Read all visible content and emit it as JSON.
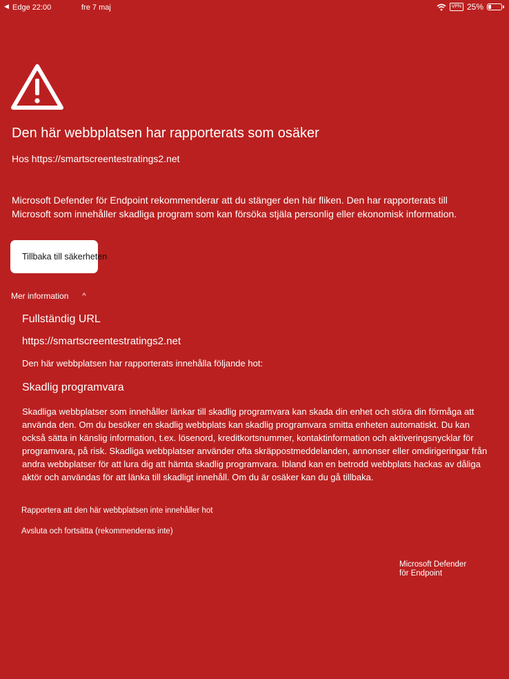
{
  "status_bar": {
    "back_arrow": "◀",
    "app_time": "Edge 22:00",
    "date": "fre 7 maj",
    "vpn": "VPN",
    "battery_percent": "25%",
    "battery_level": 0.25
  },
  "warning": {
    "title": "Den här webbplatsen har rapporterats som osäker",
    "site": "Hos https://smartscreentestratings2.net",
    "message": "Microsoft Defender för Endpoint rekommenderar att du stänger den här fliken. Den har rapporterats till Microsoft som innehåller skadliga program som kan försöka stjäla personlig eller ekonomisk information.",
    "back_button": "Tillbaka till säkerheten"
  },
  "more_info": {
    "toggle_label": "Mer information",
    "chevron": "^",
    "full_url_heading": "Fullständig URL",
    "full_url": "https://smartscreentestratings2.net",
    "threats_intro": "Den här webbplatsen har rapporterats innehålla följande hot:",
    "threat_heading": "Skadlig programvara",
    "threat_description": "Skadliga webbplatser som innehåller länkar till skadlig programvara kan skada din enhet och störa din förmåga att använda den. Om du besöker en skadlig webbplats kan skadlig programvara smitta enheten automatiskt. Du kan också sätta in känslig information, t.ex. lösenord, kreditkortsnummer, kontaktinformation och aktiveringsnycklar för programvara, på risk. Skadliga webbplatser använder ofta skräppostmeddelanden, annonser eller omdirigeringar från andra webbplatser för att lura dig att hämta skadlig programvara. Ibland kan en betrodd webbplats hackas av dåliga aktör och användas för att länka till skadligt innehåll. Om du är osäker kan du gå tillbaka.",
    "report_link": "Rapportera att den här webbplatsen inte innehåller hot",
    "continue_link": "Avsluta och fortsätta (rekommenderas inte)"
  },
  "brand": {
    "line1": "Microsoft Defender",
    "line2": "för Endpoint"
  },
  "colors": {
    "background": "#bb2020",
    "text": "#ffffff",
    "button_bg": "#ffffff"
  }
}
